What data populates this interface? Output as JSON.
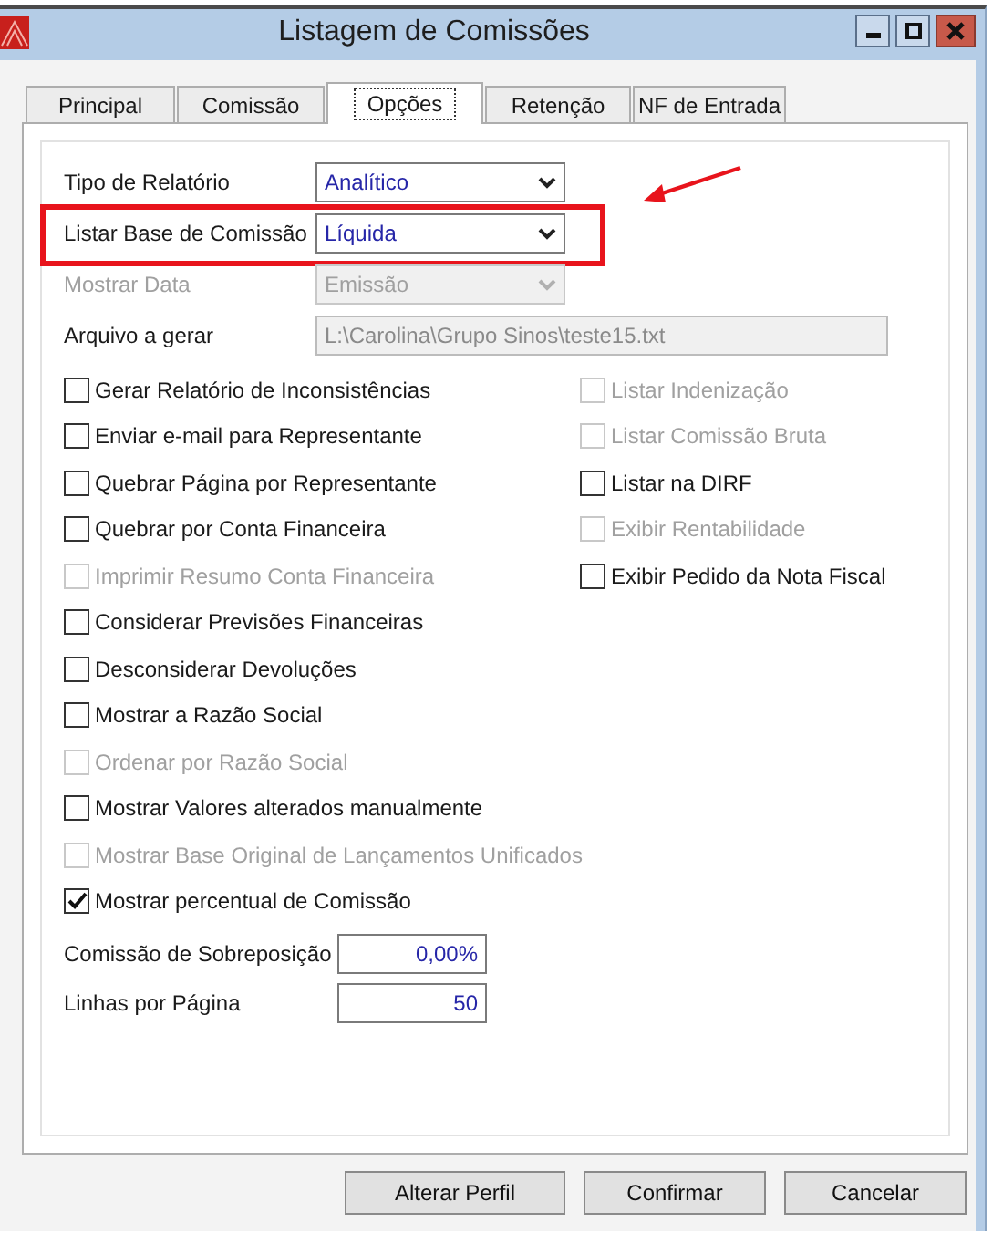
{
  "window": {
    "title": "Listagem de Comissões"
  },
  "tabs": [
    {
      "label": "Principal",
      "selected": false
    },
    {
      "label": "Comissão",
      "selected": false
    },
    {
      "label": "Opções",
      "selected": true
    },
    {
      "label": "Retenção",
      "selected": false
    },
    {
      "label": "NF de Entrada",
      "selected": false
    }
  ],
  "fields": [
    {
      "kind": "select",
      "label": "Tipo de Relatório",
      "value": "Analítico",
      "disabled": false,
      "highlighted": false
    },
    {
      "kind": "select",
      "label": "Listar Base de Comissão",
      "value": "Líquida",
      "disabled": false,
      "highlighted": true
    },
    {
      "kind": "select",
      "label": "Mostrar Data",
      "value": "Emissão",
      "disabled": true,
      "highlighted": false
    },
    {
      "kind": "text",
      "label": "Arquivo a gerar",
      "value": "L:\\Carolina\\Grupo Sinos\\teste15.txt",
      "disabled": true,
      "highlighted": false
    }
  ],
  "checkboxes_left": [
    {
      "label": "Gerar Relatório de Inconsistências",
      "checked": false,
      "disabled": false
    },
    {
      "label": "Enviar e-mail para Representante",
      "checked": false,
      "disabled": false
    },
    {
      "label": "Quebrar Página por Representante",
      "checked": false,
      "disabled": false
    },
    {
      "label": "Quebrar por Conta Financeira",
      "checked": false,
      "disabled": false
    },
    {
      "label": "Imprimir Resumo Conta Financeira",
      "checked": false,
      "disabled": true
    },
    {
      "label": "Considerar Previsões Financeiras",
      "checked": false,
      "disabled": false
    },
    {
      "label": "Desconsiderar Devoluções",
      "checked": false,
      "disabled": false
    },
    {
      "label": "Mostrar a Razão Social",
      "checked": false,
      "disabled": false
    },
    {
      "label": "Ordenar por Razão Social",
      "checked": false,
      "disabled": true
    },
    {
      "label": "Mostrar Valores alterados manualmente",
      "checked": false,
      "disabled": false
    },
    {
      "label": "Mostrar Base Original de Lançamentos Unificados",
      "checked": false,
      "disabled": true
    },
    {
      "label": "Mostrar percentual de Comissão",
      "checked": true,
      "disabled": false
    }
  ],
  "checkboxes_right": [
    {
      "label": "Listar Indenização",
      "checked": false,
      "disabled": true
    },
    {
      "label": "Listar Comissão Bruta",
      "checked": false,
      "disabled": true
    },
    {
      "label": "Listar na DIRF",
      "checked": false,
      "disabled": false
    },
    {
      "label": "Exibir Rentabilidade",
      "checked": false,
      "disabled": true
    },
    {
      "label": "Exibir Pedido da Nota Fiscal",
      "checked": false,
      "disabled": false
    }
  ],
  "numeric_fields": [
    {
      "label": "Comissão de Sobreposição",
      "value": "0,00%"
    },
    {
      "label": "Linhas por Página",
      "value": "50"
    }
  ],
  "buttons": [
    "Alterar Perfil",
    "Confirmar",
    "Cancelar"
  ]
}
